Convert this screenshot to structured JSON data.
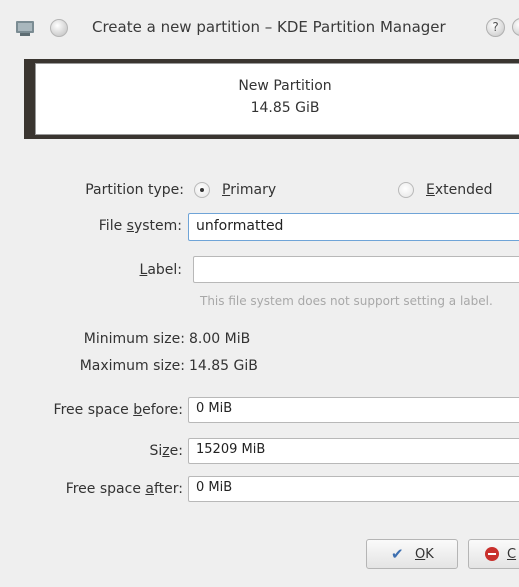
{
  "window": {
    "title": "Create a new partition – KDE Partition Manager",
    "help_glyph": "?",
    "icons": [
      "partition-manager-icon",
      "pin-icon",
      "help-icon",
      "close-icon"
    ]
  },
  "partition_preview": {
    "name": "New Partition",
    "size": "14.85 GiB"
  },
  "form": {
    "partition_type": {
      "label_pre": "Partition type: ",
      "primary": {
        "accel": "P",
        "rest": "rimary",
        "checked": true
      },
      "extended": {
        "accel": "E",
        "rest": "xtended",
        "checked": false
      }
    },
    "file_system": {
      "label_pre": "File ",
      "label_accel": "s",
      "label_post": "ystem:",
      "value": "unformatted"
    },
    "label": {
      "label_accel": "L",
      "label_post": "abel:",
      "value": "",
      "hint": "This file system does not support setting a label."
    },
    "min_size": {
      "label": "Minimum size:",
      "value": "8.00 MiB"
    },
    "max_size": {
      "label": "Maximum size:",
      "value": "14.85 GiB"
    },
    "free_before": {
      "label_pre": "Free space ",
      "label_accel": "b",
      "label_post": "efore:",
      "value": "0 MiB"
    },
    "size": {
      "label_pre": "Si",
      "label_accel": "z",
      "label_post": "e:",
      "value": "15209 MiB"
    },
    "free_after": {
      "label_pre": "Free space ",
      "label_accel": "a",
      "label_post": "fter:",
      "value": "0 MiB"
    }
  },
  "buttons": {
    "ok": {
      "accel": "O",
      "rest": "K",
      "icon": "checkmark-icon",
      "color": "#3d6fb0"
    },
    "cancel": {
      "accel": "C",
      "icon": "cancel-icon",
      "color": "#c9302c"
    }
  }
}
